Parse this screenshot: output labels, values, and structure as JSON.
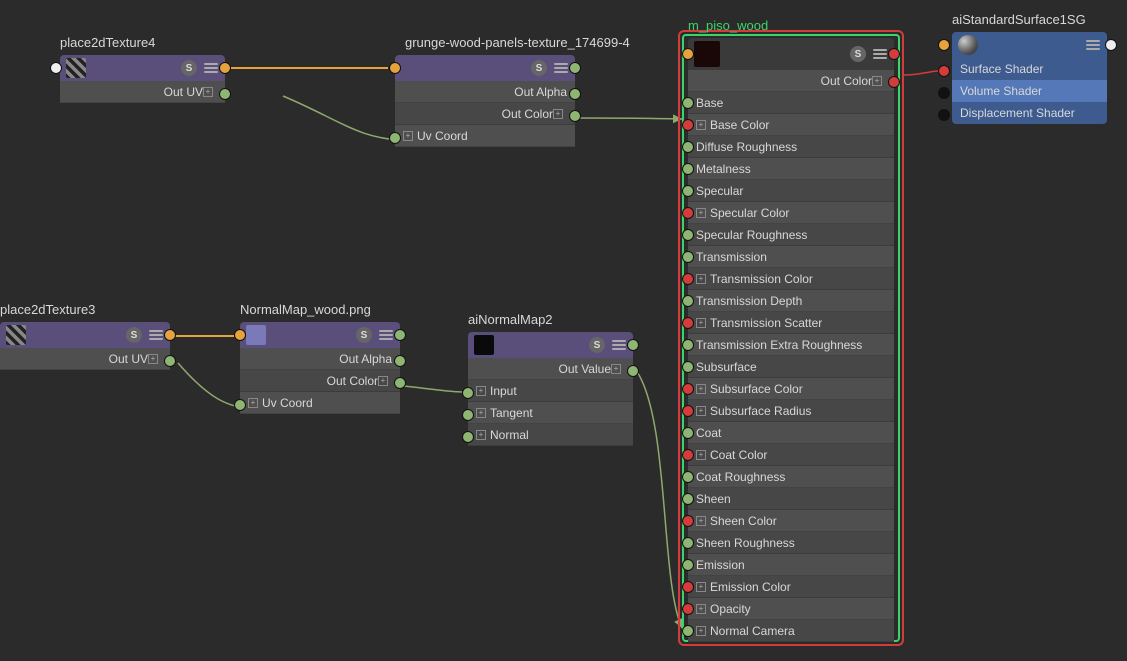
{
  "nodes": {
    "place2dTexture4": {
      "title": "place2dTexture4",
      "out_uv": "Out UV"
    },
    "grungeWood": {
      "title": "grunge-wood-panels-texture_174699-4",
      "out_alpha": "Out Alpha",
      "out_color": "Out Color",
      "uv_coord": "Uv Coord"
    },
    "place2dTexture3": {
      "title": "place2dTexture3",
      "out_uv": "Out UV"
    },
    "normalMapWood": {
      "title": "NormalMap_wood.png",
      "out_alpha": "Out Alpha",
      "out_color": "Out Color",
      "uv_coord": "Uv Coord"
    },
    "aiNormalMap2": {
      "title": "aiNormalMap2",
      "out_value": "Out Value",
      "input": "Input",
      "tangent": "Tangent",
      "normal": "Normal"
    },
    "m_piso_wood": {
      "title": "m_piso_wood",
      "out_color": "Out Color",
      "attrs": [
        {
          "label": "Base",
          "exp": false,
          "red": false
        },
        {
          "label": "Base Color",
          "exp": true,
          "red": true
        },
        {
          "label": "Diffuse Roughness",
          "exp": false,
          "red": false
        },
        {
          "label": "Metalness",
          "exp": false,
          "red": false
        },
        {
          "label": "Specular",
          "exp": false,
          "red": false
        },
        {
          "label": "Specular Color",
          "exp": true,
          "red": true
        },
        {
          "label": "Specular Roughness",
          "exp": false,
          "red": false
        },
        {
          "label": "Transmission",
          "exp": false,
          "red": false
        },
        {
          "label": "Transmission Color",
          "exp": true,
          "red": true
        },
        {
          "label": "Transmission Depth",
          "exp": false,
          "red": false
        },
        {
          "label": "Transmission Scatter",
          "exp": true,
          "red": true
        },
        {
          "label": "Transmission Extra Roughness",
          "exp": false,
          "red": false
        },
        {
          "label": "Subsurface",
          "exp": false,
          "red": false
        },
        {
          "label": "Subsurface Color",
          "exp": true,
          "red": true
        },
        {
          "label": "Subsurface Radius",
          "exp": true,
          "red": true
        },
        {
          "label": "Coat",
          "exp": false,
          "red": false
        },
        {
          "label": "Coat Color",
          "exp": true,
          "red": true
        },
        {
          "label": "Coat Roughness",
          "exp": false,
          "red": false
        },
        {
          "label": "Sheen",
          "exp": false,
          "red": false
        },
        {
          "label": "Sheen Color",
          "exp": true,
          "red": true
        },
        {
          "label": "Sheen Roughness",
          "exp": false,
          "red": false
        },
        {
          "label": "Emission",
          "exp": false,
          "red": false
        },
        {
          "label": "Emission Color",
          "exp": true,
          "red": true
        },
        {
          "label": "Opacity",
          "exp": true,
          "red": true
        },
        {
          "label": "Normal Camera",
          "exp": true,
          "red": false
        }
      ]
    },
    "sg": {
      "title": "aiStandardSurface1SG",
      "surface": "Surface Shader",
      "volume": "Volume Shader",
      "disp": "Displacement Shader"
    }
  },
  "icons": {
    "s_label": "S"
  },
  "colors": {
    "wood_swatch": "#6b3a1f",
    "normal_swatch": "#7a7ab8",
    "ai_swatch": "#0a0a0a",
    "piso_swatch": "#1a0808"
  }
}
